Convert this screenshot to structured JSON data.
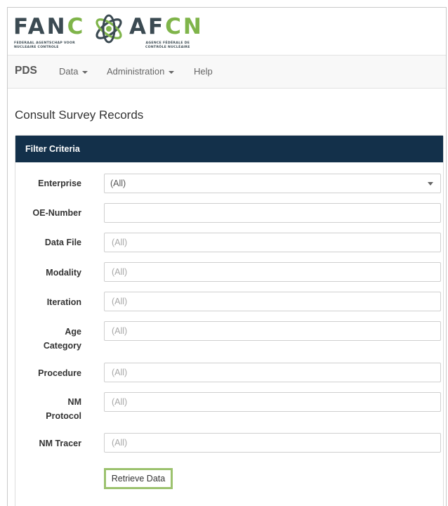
{
  "logo": {
    "left_word_dark": "FAN",
    "left_word_green": "C",
    "right_word_dark": "AF",
    "right_word_green": "CN",
    "left_sub_line1": "FEDERAAL AGENTSCHAP VOOR",
    "left_sub_line2": "NUCLEAIRE CONTROLE",
    "right_sub_line1": "AGENCE FÉDÉRALE DE",
    "right_sub_line2": "CONTRÔLE NUCLÉAIRE",
    "emblem_icon": "atom-emblem-icon",
    "colors": {
      "dark": "#3b4a52",
      "green": "#7fb44a"
    }
  },
  "navbar": {
    "brand": "PDS",
    "items": [
      {
        "label": "Data",
        "dropdown": true
      },
      {
        "label": "Administration",
        "dropdown": true
      },
      {
        "label": "Help",
        "dropdown": false
      }
    ]
  },
  "page": {
    "title": "Consult Survey Records"
  },
  "panel": {
    "heading": "Filter Criteria",
    "heading_color": "#13304a",
    "fields": {
      "enterprise": {
        "label": "Enterprise",
        "value": "(All)"
      },
      "oe_number": {
        "label": "OE-Number",
        "value": "",
        "placeholder": ""
      },
      "data_file": {
        "label": "Data File",
        "placeholder": "(All)"
      },
      "modality": {
        "label": "Modality",
        "placeholder": "(All)"
      },
      "iteration": {
        "label": "Iteration",
        "placeholder": "(All)"
      },
      "age_category": {
        "label_line1": "Age",
        "label_line2": "Category",
        "placeholder": "(All)"
      },
      "procedure": {
        "label": "Procedure",
        "placeholder": "(All)"
      },
      "nm_protocol": {
        "label_line1": "NM",
        "label_line2": "Protocol",
        "placeholder": "(All)"
      },
      "nm_tracer": {
        "label": "NM Tracer",
        "placeholder": "(All)"
      }
    },
    "retrieve_button": {
      "label": "Retrieve Data",
      "border_color": "#9cc26e"
    }
  }
}
